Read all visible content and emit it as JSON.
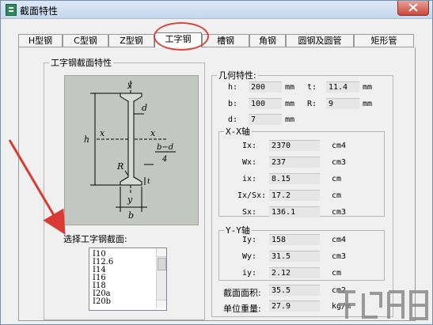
{
  "window": {
    "title": "截面特性"
  },
  "tabs": [
    {
      "label": "H型钢",
      "active": false
    },
    {
      "label": "C型钢",
      "active": false
    },
    {
      "label": "Z型钢",
      "active": false
    },
    {
      "label": "工字钢",
      "active": true
    },
    {
      "label": "槽钢",
      "active": false
    },
    {
      "label": "角钢",
      "active": false
    },
    {
      "label": "圆钢及圆管",
      "active": false
    },
    {
      "label": "矩形管",
      "active": false
    }
  ],
  "section_group": {
    "legend": "工字钢截面特性"
  },
  "diagram": {
    "labels": {
      "y_top": "y",
      "y_bottom": "y",
      "x_left": "x",
      "x_right": "x",
      "d": "d",
      "h": "h",
      "R": "R",
      "b": "b",
      "t": "t",
      "frac_top": "b−d",
      "frac_bottom": "4"
    }
  },
  "select_label": "选择工字钢截面:",
  "section_list": [
    "I10",
    "I12.6",
    "I14",
    "I16",
    "I18",
    "I20a",
    "I20b"
  ],
  "geometry": {
    "legend": "几何特性:",
    "h": {
      "label": "h:",
      "value": "200",
      "unit": "mm"
    },
    "t": {
      "label": "t:",
      "value": "11.4",
      "unit": "mm"
    },
    "b": {
      "label": "b:",
      "value": "100",
      "unit": "mm"
    },
    "R": {
      "label": "R:",
      "value": "9",
      "unit": "mm"
    },
    "d": {
      "label": "d:",
      "value": "7",
      "unit": "mm"
    }
  },
  "xx_axis": {
    "legend": "X-X轴",
    "rows": [
      {
        "label": "Ix:",
        "value": "2370",
        "unit": "cm4"
      },
      {
        "label": "Wx:",
        "value": "237",
        "unit": "cm3"
      },
      {
        "label": "ix:",
        "value": "8.15",
        "unit": "cm"
      },
      {
        "label": "Ix/Sx:",
        "value": "17.2",
        "unit": "cm"
      },
      {
        "label": "Sx:",
        "value": "136.1",
        "unit": "cm3"
      }
    ]
  },
  "yy_axis": {
    "legend": "Y-Y轴",
    "rows": [
      {
        "label": "Iy:",
        "value": "158",
        "unit": "cm4"
      },
      {
        "label": "Wy:",
        "value": "31.5",
        "unit": "cm3"
      },
      {
        "label": "iy:",
        "value": "2.12",
        "unit": "cm"
      }
    ]
  },
  "area": {
    "label": "截面面积:",
    "value": "35.5",
    "unit": "cm2"
  },
  "weight": {
    "label": "单位重量:",
    "value": "27.9",
    "unit": "kg/m"
  },
  "colors": {
    "highlight": "#d9453c",
    "arrow": "#d93a33",
    "diagram_bg": "#c3c7c1"
  }
}
